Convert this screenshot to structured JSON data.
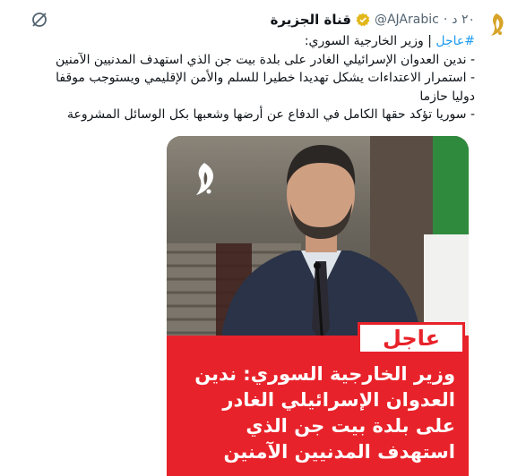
{
  "tweet": {
    "author_name": "قناة الجزيرة",
    "handle": "@AJArabic",
    "separator": "·",
    "time": "٢٠ د",
    "body_lines": [
      {
        "hashtag": "#عاجل",
        "text": " | وزير الخارجية السوري:"
      },
      {
        "text": "- ندين العدوان الإسرائيلي الغادر على بلدة بيت جن الذي استهدف المدنيين الآمنين"
      },
      {
        "text": "- استمرار الاعتداءات يشكل تهديدا خطيرا للسلم والأمن الإقليمي ويستوجب موقفا"
      },
      {
        "text": "دوليا حازما"
      },
      {
        "text": "- سوريا تؤكد حقها الكامل في الدفاع عن أرضها وشعبها بكل الوسائل المشروعة"
      }
    ]
  },
  "media": {
    "badge": "عاجل",
    "headline_lines": [
      "وزير الخارجية السوري: ندين",
      "العدوان الإسرائيلي الغادر",
      "على بلدة بيت جن الذي",
      "استهدف المدنيين الآمنين"
    ]
  },
  "icons": {
    "avatar": "aljazeera-logo-icon",
    "verified": "verified-badge-icon",
    "grok": "grok-icon",
    "watermark": "aljazeera-watermark-icon"
  },
  "colors": {
    "accent": "#1d9bf0",
    "verified_gold": "#e2b719",
    "breaking_red": "#e8222a"
  }
}
